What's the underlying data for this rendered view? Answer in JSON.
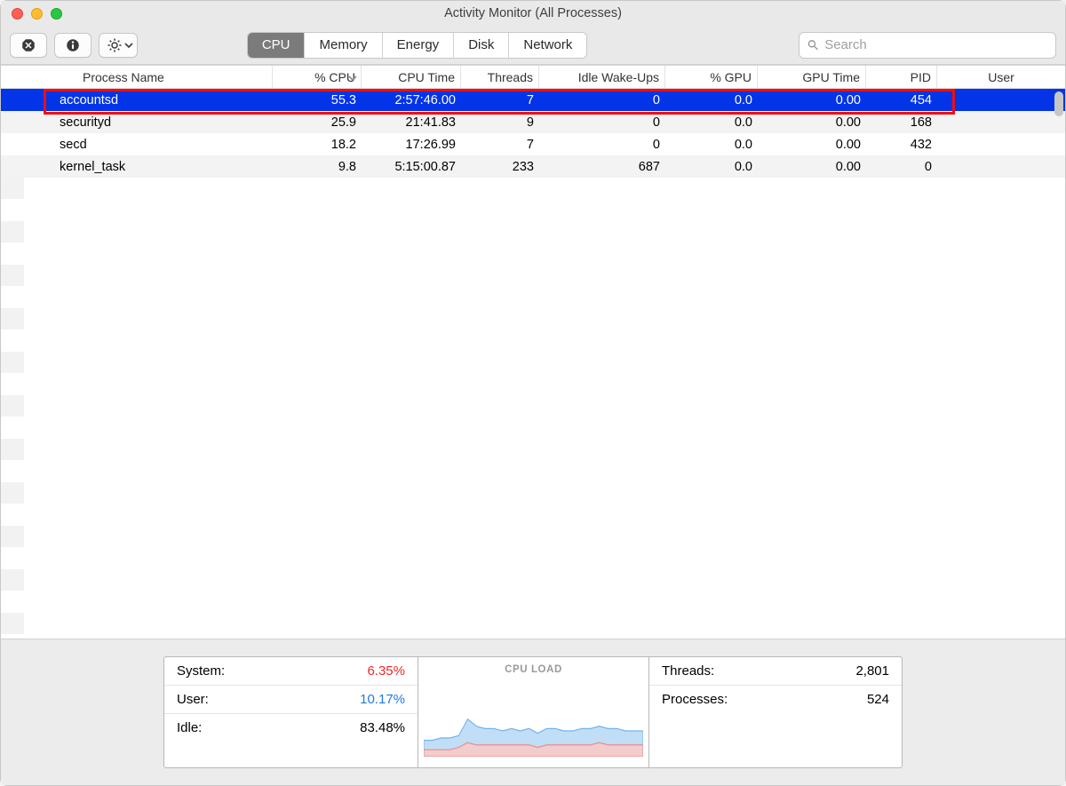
{
  "window_title": "Activity Monitor (All Processes)",
  "tabs": {
    "cpu": "CPU",
    "memory": "Memory",
    "energy": "Energy",
    "disk": "Disk",
    "network": "Network"
  },
  "search": {
    "placeholder": "Search"
  },
  "columns": {
    "name": "Process Name",
    "cpu": "% CPU",
    "cput": "CPU Time",
    "thr": "Threads",
    "idle": "Idle Wake-Ups",
    "gpu": "% GPU",
    "gput": "GPU Time",
    "pid": "PID",
    "user": "User"
  },
  "rows": [
    {
      "name": "accountsd",
      "cpu": "55.3",
      "cput": "2:57:46.00",
      "thr": "7",
      "idle": "0",
      "gpu": "0.0",
      "gput": "0.00",
      "pid": "454",
      "selected": true
    },
    {
      "name": "securityd",
      "cpu": "25.9",
      "cput": "21:41.83",
      "thr": "9",
      "idle": "0",
      "gpu": "0.0",
      "gput": "0.00",
      "pid": "168",
      "selected": false
    },
    {
      "name": "secd",
      "cpu": "18.2",
      "cput": "17:26.99",
      "thr": "7",
      "idle": "0",
      "gpu": "0.0",
      "gput": "0.00",
      "pid": "432",
      "selected": false
    },
    {
      "name": "kernel_task",
      "cpu": "9.8",
      "cput": "5:15:00.87",
      "thr": "233",
      "idle": "687",
      "gpu": "0.0",
      "gput": "0.00",
      "pid": "0",
      "selected": false
    }
  ],
  "footer": {
    "system_label": "System:",
    "system_value": "6.35%",
    "user_label": "User:",
    "user_value": "10.17%",
    "idle_label": "Idle:",
    "idle_value": "83.48%",
    "chart_title": "CPU LOAD",
    "threads_label": "Threads:",
    "threads_value": "2,801",
    "processes_label": "Processes:",
    "processes_value": "524"
  },
  "chart_data": {
    "type": "area",
    "series": [
      {
        "name": "User",
        "color": "#86bdf1",
        "values": [
          7,
          7,
          8,
          8,
          9,
          16,
          13,
          12,
          12,
          11,
          12,
          11,
          12,
          10,
          12,
          12,
          11,
          11,
          12,
          12,
          13,
          12,
          12,
          11,
          11,
          11
        ]
      },
      {
        "name": "System",
        "color": "#f29797",
        "values": [
          3,
          3,
          3,
          3,
          4,
          6,
          5,
          5,
          5,
          5,
          5,
          5,
          5,
          4,
          5,
          5,
          5,
          5,
          5,
          5,
          6,
          5,
          5,
          5,
          5,
          5
        ]
      }
    ],
    "ymax": 100
  }
}
